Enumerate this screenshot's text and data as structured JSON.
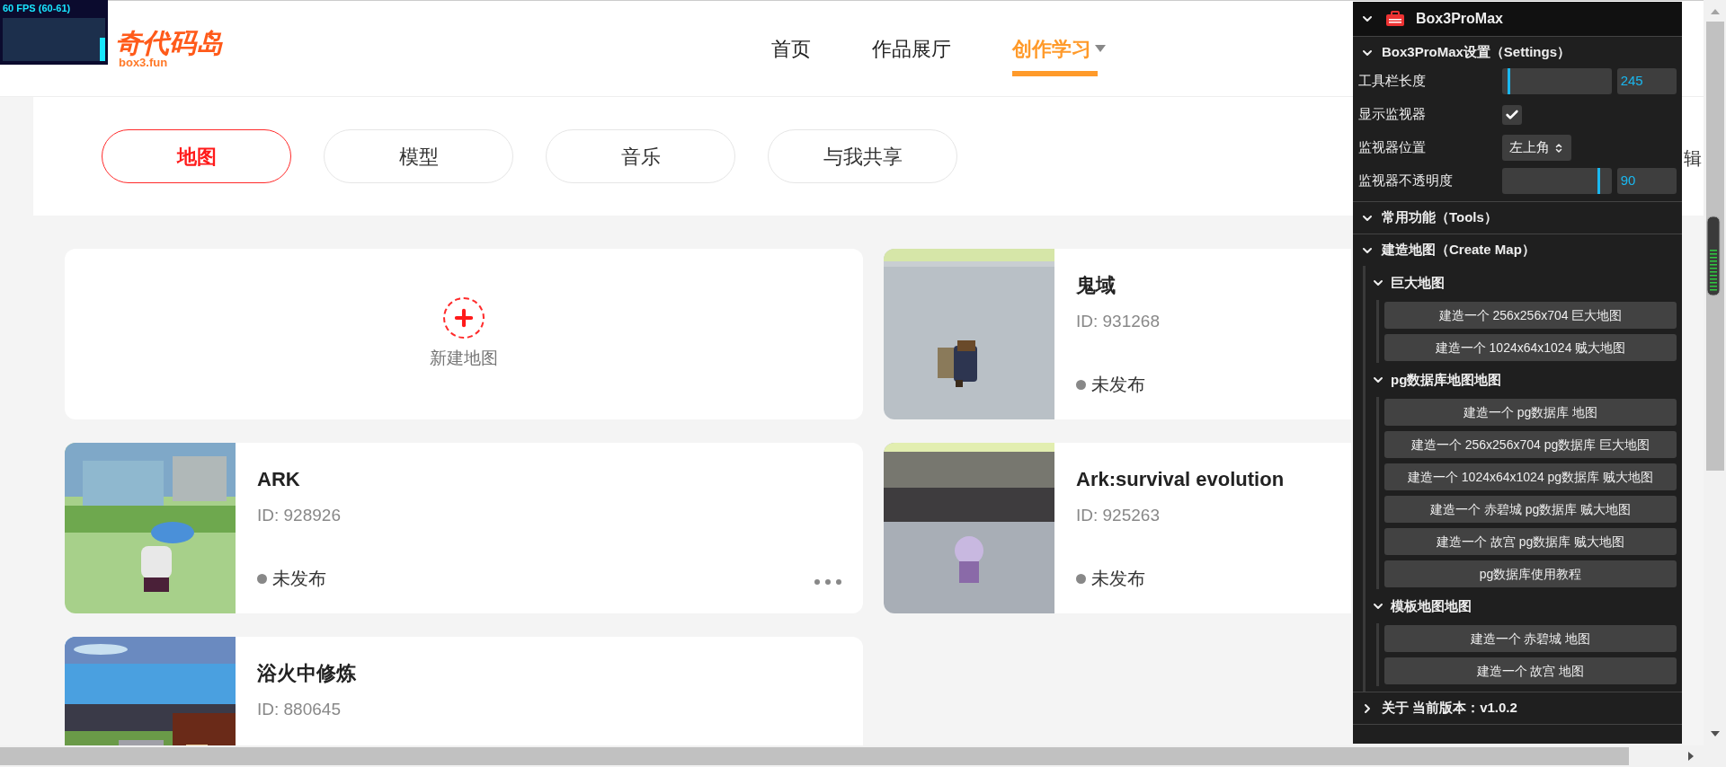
{
  "fps_monitor": {
    "text": "60 FPS (60-61)"
  },
  "logo": {
    "name": "奇代码岛",
    "domain": "box3.fun"
  },
  "nav": [
    {
      "label": "首页",
      "selected": false,
      "dropdown": false
    },
    {
      "label": "作品展厅",
      "selected": false,
      "dropdown": false
    },
    {
      "label": "创作学习",
      "selected": true,
      "dropdown": true
    }
  ],
  "categories": [
    {
      "label": "地图",
      "selected": true
    },
    {
      "label": "模型",
      "selected": false
    },
    {
      "label": "音乐",
      "selected": false
    },
    {
      "label": "与我共享",
      "selected": false
    }
  ],
  "new_map": {
    "label": "新建地图"
  },
  "maps": [
    {
      "title": "鬼域",
      "id": "ID: 931268",
      "status": "未发布"
    },
    {
      "title": "ARK",
      "id": "ID: 928926",
      "status": "未发布",
      "more_menu": true
    },
    {
      "title": "Ark:survival evolution",
      "id": "ID: 925263",
      "status": "未发布"
    },
    {
      "title": "浴火中修炼",
      "id": "ID: 880645"
    }
  ],
  "partial_text": "辑",
  "panel": {
    "title": "Box3ProMax",
    "expanded": true,
    "sections": [
      {
        "title": "Box3ProMax设置（Settings）",
        "expanded": true,
        "settings": [
          {
            "kind": "slider",
            "label": "工具栏长度",
            "level": 0.05,
            "value": "245"
          },
          {
            "kind": "checkbox",
            "label": "显示监视器",
            "checked": true
          },
          {
            "kind": "select",
            "label": "监视器位置",
            "value": "左上角"
          },
          {
            "kind": "slider",
            "label": "监视器不透明度",
            "level": 0.88,
            "value": "90"
          }
        ]
      },
      {
        "title": "常用功能（Tools）",
        "expanded": true
      },
      {
        "title": "建造地图（Create Map）",
        "expanded": true,
        "groups": [
          {
            "title": "巨大地图",
            "expanded": true,
            "buttons": [
              "建造一个 256x256x704 巨大地图",
              "建造一个 1024x64x1024 贼大地图"
            ]
          },
          {
            "title": "pg数据库地图地图",
            "expanded": true,
            "buttons": [
              "建造一个 pg数据库 地图",
              "建造一个 256x256x704 pg数据库 巨大地图",
              "建造一个 1024x64x1024 pg数据库 贼大地图",
              "建造一个 赤碧城 pg数据库 贼大地图",
              "建造一个 故宫 pg数据库 贼大地图",
              "pg数据库使用教程"
            ]
          },
          {
            "title": "模板地图地图",
            "expanded": true,
            "buttons": [
              "建造一个 赤碧城 地图",
              "建造一个 故宫 地图"
            ]
          }
        ]
      },
      {
        "title": "关于 当前版本：v1.0.2",
        "expanded": false
      }
    ]
  }
}
